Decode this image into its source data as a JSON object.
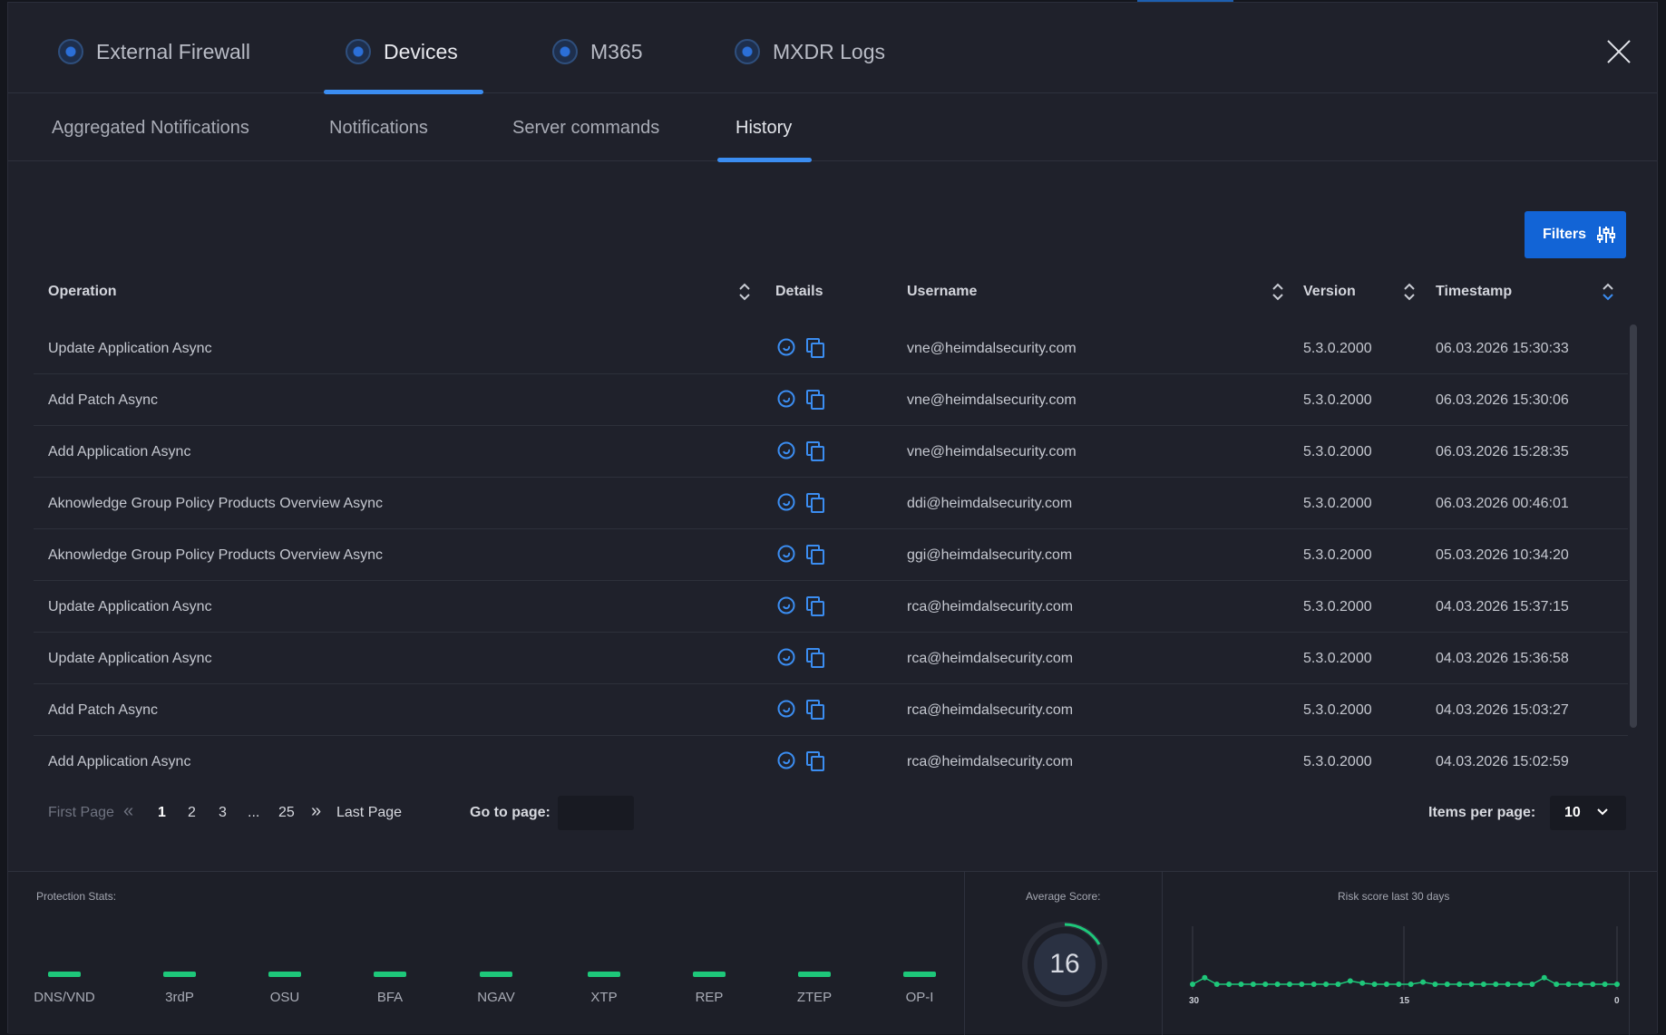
{
  "top_tabs": [
    {
      "label": "External Firewall"
    },
    {
      "label": "Devices"
    },
    {
      "label": "M365"
    },
    {
      "label": "MXDR Logs"
    }
  ],
  "sub_tabs": [
    {
      "label": "Aggregated Notifications"
    },
    {
      "label": "Notifications"
    },
    {
      "label": "Server commands"
    },
    {
      "label": "History"
    }
  ],
  "filters_label": "Filters",
  "columns": {
    "operation": "Operation",
    "details": "Details",
    "username": "Username",
    "version": "Version",
    "timestamp": "Timestamp"
  },
  "rows": [
    {
      "operation": "Update Application Async",
      "username": "vne@heimdalsecurity.com",
      "version": "5.3.0.2000",
      "timestamp": "06.03.2026  15:30:33"
    },
    {
      "operation": "Add Patch Async",
      "username": "vne@heimdalsecurity.com",
      "version": "5.3.0.2000",
      "timestamp": "06.03.2026  15:30:06"
    },
    {
      "operation": "Add Application Async",
      "username": "vne@heimdalsecurity.com",
      "version": "5.3.0.2000",
      "timestamp": "06.03.2026  15:28:35"
    },
    {
      "operation": "Aknowledge Group Policy Products Overview Async",
      "username": "ddi@heimdalsecurity.com",
      "version": "5.3.0.2000",
      "timestamp": "06.03.2026  00:46:01"
    },
    {
      "operation": "Aknowledge Group Policy Products Overview Async",
      "username": "ggi@heimdalsecurity.com",
      "version": "5.3.0.2000",
      "timestamp": "05.03.2026  10:34:20"
    },
    {
      "operation": "Update Application Async",
      "username": "rca@heimdalsecurity.com",
      "version": "5.3.0.2000",
      "timestamp": "04.03.2026  15:37:15"
    },
    {
      "operation": "Update Application Async",
      "username": "rca@heimdalsecurity.com",
      "version": "5.3.0.2000",
      "timestamp": "04.03.2026  15:36:58"
    },
    {
      "operation": "Add Patch Async",
      "username": "rca@heimdalsecurity.com",
      "version": "5.3.0.2000",
      "timestamp": "04.03.2026  15:03:27"
    },
    {
      "operation": "Add Application Async",
      "username": "rca@heimdalsecurity.com",
      "version": "5.3.0.2000",
      "timestamp": "04.03.2026  15:02:59"
    }
  ],
  "pagination": {
    "first": "First Page",
    "pages": [
      "1",
      "2",
      "3",
      "...",
      "25"
    ],
    "last": "Last Page",
    "goto_label": "Go to page:",
    "items_per_page_label": "Items per page:",
    "items_per_page_value": "10"
  },
  "footer": {
    "protection_label": "Protection Stats:",
    "stats": [
      "DNS/VND",
      "3rdP",
      "OSU",
      "BFA",
      "NGAV",
      "XTP",
      "REP",
      "ZTEP",
      "OP-I"
    ],
    "average_label": "Average Score:",
    "average_value": "16",
    "risk_label": "Risk score last 30 days",
    "risk_ticks": [
      "30",
      "15",
      "0"
    ]
  },
  "chart_data": {
    "type": "line",
    "title": "Risk score last 30 days",
    "x_ticks": [
      "30",
      "15",
      "0"
    ],
    "values": [
      16,
      22,
      16,
      16,
      16,
      16,
      16,
      16,
      16,
      16,
      16,
      16,
      16,
      19,
      17,
      16,
      16,
      16,
      16,
      18,
      16,
      16,
      16,
      16,
      16,
      16,
      16,
      16,
      16,
      22,
      16,
      16,
      16,
      16,
      16,
      16
    ]
  },
  "colors": {
    "accent": "#3b8df1",
    "button": "#1264d6",
    "stat_green": "#1ec77a"
  }
}
